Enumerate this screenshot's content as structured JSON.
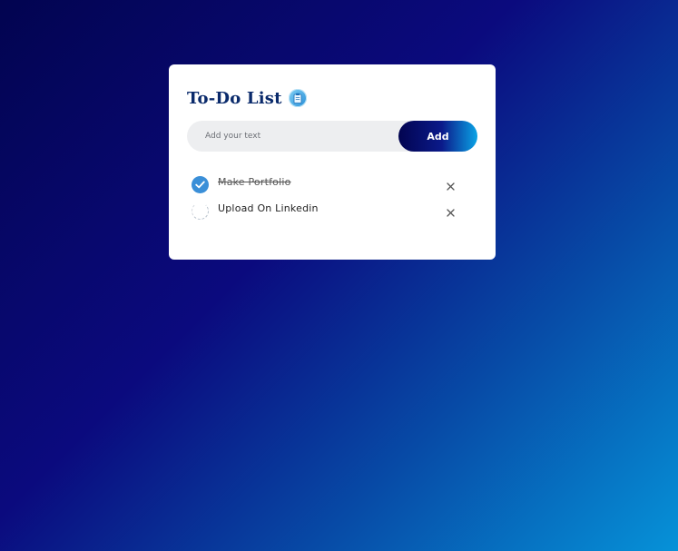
{
  "todo": {
    "title": "To-Do List",
    "title_icon": "clipboard-icon",
    "input": {
      "placeholder": "Add your text",
      "value": ""
    },
    "add_label": "Add",
    "items": [
      {
        "label": "Make Portfolio",
        "checked": true
      },
      {
        "label": "Upload On Linkedin",
        "checked": false
      }
    ]
  },
  "colors": {
    "background_start": "#020450",
    "background_end": "#0692d8",
    "title": "#0a2a6b",
    "check_done": "#3a8fd8",
    "add_button_start": "#020450",
    "add_button_end": "#0aa4e6"
  }
}
